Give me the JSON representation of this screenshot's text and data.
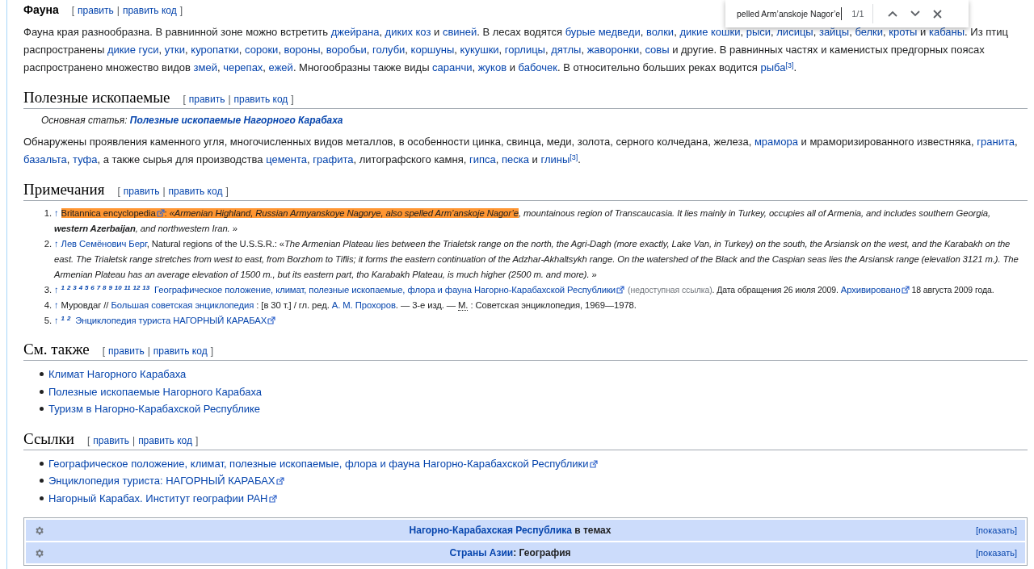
{
  "find_bar": {
    "query": "pelled Arm’anskoje Nagor’e",
    "count": "1/1"
  },
  "sections": [
    {
      "kind": "h3",
      "title": "Фауна",
      "open": "[",
      "edit": "править",
      "sep": "|",
      "edit_code": "править код",
      "close": "]",
      "blocks": [
        {
          "kind": "paragraph",
          "segments": [
            {
              "kind": "text",
              "text": "Фауна края разнообразна. В равнинной зоне можно встретить "
            },
            {
              "kind": "link",
              "text": "джейрана"
            },
            {
              "kind": "text",
              "text": ", "
            },
            {
              "kind": "link",
              "text": "диких коз"
            },
            {
              "kind": "text",
              "text": " и "
            },
            {
              "kind": "link",
              "text": "свиней"
            },
            {
              "kind": "text",
              "text": ". В лесах водятся "
            },
            {
              "kind": "link",
              "text": "бурые медведи"
            },
            {
              "kind": "text",
              "text": ", "
            },
            {
              "kind": "link",
              "text": "волки"
            },
            {
              "kind": "text",
              "text": ", "
            },
            {
              "kind": "link",
              "text": "дикие кошки"
            },
            {
              "kind": "text",
              "text": ", "
            },
            {
              "kind": "link",
              "text": "рыси"
            },
            {
              "kind": "text",
              "text": ", "
            },
            {
              "kind": "link",
              "text": "лисицы"
            },
            {
              "kind": "text",
              "text": ", "
            },
            {
              "kind": "link",
              "text": "зайцы"
            },
            {
              "kind": "text",
              "text": ", "
            },
            {
              "kind": "link",
              "text": "белки"
            },
            {
              "kind": "text",
              "text": ", "
            },
            {
              "kind": "link",
              "text": "кроты"
            },
            {
              "kind": "text",
              "text": " и "
            },
            {
              "kind": "link",
              "text": "кабаны"
            },
            {
              "kind": "text",
              "text": ". Из птиц распространены "
            },
            {
              "kind": "link",
              "text": "дикие гуси"
            },
            {
              "kind": "text",
              "text": ", "
            },
            {
              "kind": "link",
              "text": "утки"
            },
            {
              "kind": "text",
              "text": ", "
            },
            {
              "kind": "link",
              "text": "куропатки"
            },
            {
              "kind": "text",
              "text": ", "
            },
            {
              "kind": "link",
              "text": "сороки"
            },
            {
              "kind": "text",
              "text": ", "
            },
            {
              "kind": "link",
              "text": "вороны"
            },
            {
              "kind": "text",
              "text": ", "
            },
            {
              "kind": "link",
              "text": "воробьи"
            },
            {
              "kind": "text",
              "text": ", "
            },
            {
              "kind": "link",
              "text": "голуби"
            },
            {
              "kind": "text",
              "text": ", "
            },
            {
              "kind": "link",
              "text": "коршуны"
            },
            {
              "kind": "text",
              "text": ", "
            },
            {
              "kind": "link",
              "text": "кукушки"
            },
            {
              "kind": "text",
              "text": ", "
            },
            {
              "kind": "link",
              "text": "горлицы"
            },
            {
              "kind": "text",
              "text": ", "
            },
            {
              "kind": "link",
              "text": "дятлы"
            },
            {
              "kind": "text",
              "text": ", "
            },
            {
              "kind": "link",
              "text": "жаворонки"
            },
            {
              "kind": "text",
              "text": ", "
            },
            {
              "kind": "link",
              "text": "совы"
            },
            {
              "kind": "text",
              "text": " и другие. В равнинных частях и каменистых предгорных поясах распространено множество видов "
            },
            {
              "kind": "link",
              "text": "змей"
            },
            {
              "kind": "text",
              "text": ", "
            },
            {
              "kind": "link",
              "text": "черепах"
            },
            {
              "kind": "text",
              "text": ", "
            },
            {
              "kind": "link",
              "text": "ежей"
            },
            {
              "kind": "text",
              "text": ". Многообразны также виды "
            },
            {
              "kind": "link",
              "text": "саранчи"
            },
            {
              "kind": "text",
              "text": ", "
            },
            {
              "kind": "link",
              "text": "жуков"
            },
            {
              "kind": "text",
              "text": " и "
            },
            {
              "kind": "link",
              "text": "бабочек"
            },
            {
              "kind": "text",
              "text": ". В относительно больших реках водится "
            },
            {
              "kind": "link",
              "text": "рыба"
            },
            {
              "kind": "sup",
              "text": "[3]"
            },
            {
              "kind": "text",
              "text": "."
            }
          ]
        }
      ]
    },
    {
      "kind": "h2",
      "title": "Полезные ископаемые",
      "open": "[",
      "edit": "править",
      "sep": "|",
      "edit_code": "править код",
      "close": "]",
      "blocks": [
        {
          "kind": "hatnote",
          "label": "Основная статья:",
          "link": "Полезные ископаемые Нагорного Карабаха"
        },
        {
          "kind": "paragraph",
          "segments": [
            {
              "kind": "text",
              "text": "Обнаружены проявления каменного угля, многочисленных видов металлов, в особенности цинка, свинца, меди, золота, серного колчедана, железа, "
            },
            {
              "kind": "link",
              "text": "мрамора"
            },
            {
              "kind": "text",
              "text": " и мраморизированного известняка, "
            },
            {
              "kind": "link",
              "text": "гранита"
            },
            {
              "kind": "text",
              "text": ", "
            },
            {
              "kind": "link",
              "text": "базальта"
            },
            {
              "kind": "text",
              "text": ", "
            },
            {
              "kind": "link",
              "text": "туфа"
            },
            {
              "kind": "text",
              "text": ", а также сырья для производства "
            },
            {
              "kind": "link",
              "text": "цемента"
            },
            {
              "kind": "text",
              "text": ", "
            },
            {
              "kind": "link",
              "text": "графита"
            },
            {
              "kind": "text",
              "text": ", литографского камня, "
            },
            {
              "kind": "link",
              "text": "гипса"
            },
            {
              "kind": "text",
              "text": ", "
            },
            {
              "kind": "link",
              "text": "песка"
            },
            {
              "kind": "text",
              "text": " и "
            },
            {
              "kind": "link",
              "text": "глины"
            },
            {
              "kind": "sup",
              "text": "[3]"
            },
            {
              "kind": "text",
              "text": "."
            }
          ]
        }
      ]
    },
    {
      "kind": "h2",
      "title": "Примечания",
      "open": "[",
      "edit": "править",
      "sep": "|",
      "edit_code": "править код",
      "close": "]",
      "blocks": [
        {
          "kind": "references",
          "items": [
            {
              "number": "1.",
              "arrow": "↑",
              "highlighted": [
                {
                  "kind": "ext",
                  "text": "Britannica encyclopedia"
                },
                {
                  "kind": "text",
                  "text": ": "
                },
                {
                  "kind": "italic",
                  "text": "«Armenian Highland, Russian Armyanskoye Nagorye, also spelled Arm’anskoje Nagor’e"
                }
              ],
              "segments": [
                {
                  "kind": "italic",
                  "text": ", mountainous region of Transcaucasia. It lies mainly in Turkey, occupies all of Armenia, and includes southern Georgia, "
                },
                {
                  "kind": "bolditalic",
                  "text": "western Azerbaijan"
                },
                {
                  "kind": "italic",
                  "text": ", and northwestern Iran."
                },
                {
                  "kind": "text",
                  "text": " »"
                }
              ]
            },
            {
              "number": "2.",
              "arrow": "↑",
              "segments": [
                {
                  "kind": "link",
                  "text": "Лев Семёнович Берг"
                },
                {
                  "kind": "text",
                  "text": ", Natural regions of the U.S.S.R.: «"
                },
                {
                  "kind": "italic",
                  "text": "The Armenian Plateau lies between the Trialetsk range on the north, the Agri-Dagh (more exactly, Lake Van, in Turkey) on the south, the Arsiansk on the west, and the Karabakh on the east. The Trialetsk range stretches from west to east, from Borzhom to Tiflis; it forms the eastern continuation of the Adzhar-Akhaltsykh range. On the watershed of the Black and the Caspian seas lies the Arsiansk range (elevation 3121 m.). The Armenian Plateau has an average elevation of 1500 m., but its eastern part, tho Karabakh Plateau, is much higher (2500 m. and more)."
                },
                {
                  "kind": "text",
                  "text": " »"
                }
              ]
            },
            {
              "number": "3.",
              "arrow": "↑",
              "backlinks": [
                "1",
                "2",
                "3",
                "4",
                "5",
                "6",
                "7",
                "8",
                "9",
                "10",
                "11",
                "12",
                "13"
              ],
              "segments": [
                {
                  "kind": "ext",
                  "text": "Географическое положение, климат, полезные ископаемые, флора и фауна Нагорно-Карабахской Республики"
                },
                {
                  "kind": "grey",
                  "text": "(недоступная ссылка)"
                },
                {
                  "kind": "small",
                  "text": ". Дата обращения 26 июля 2009. "
                },
                {
                  "kind": "ext",
                  "text": "Архивировано"
                },
                {
                  "kind": "small",
                  "text": " 18 августа 2009 года."
                }
              ]
            },
            {
              "number": "4.",
              "arrow": "↑",
              "segments": [
                {
                  "kind": "text",
                  "text": "Муровдаг // "
                },
                {
                  "kind": "link",
                  "text": "Большая советская энциклопедия"
                },
                {
                  "kind": "text",
                  "text": " : [в 30 т.] / гл. ред. "
                },
                {
                  "kind": "link",
                  "text": "А. М. Прохоров"
                },
                {
                  "kind": "text",
                  "text": ". — 3-е изд. — "
                },
                {
                  "kind": "abbr",
                  "text": "М."
                },
                {
                  "kind": "text",
                  "text": " : Советская энциклопедия, 1969—1978."
                }
              ]
            },
            {
              "number": "5.",
              "arrow": "↑",
              "backlinks": [
                "1",
                "2"
              ],
              "segments": [
                {
                  "kind": "ext",
                  "text": "Энциклопедия туриста НАГОРНЫЙ КАРАБАХ"
                }
              ]
            }
          ]
        }
      ]
    },
    {
      "kind": "h2",
      "title": "См. также",
      "open": "[",
      "edit": "править",
      "sep": "|",
      "edit_code": "править код",
      "close": "]",
      "blocks": [
        {
          "kind": "bullets",
          "items": [
            [
              {
                "kind": "link",
                "text": "Климат Нагорного Карабаха"
              }
            ],
            [
              {
                "kind": "link",
                "text": "Полезные ископаемые Нагорного Карабаха"
              }
            ],
            [
              {
                "kind": "link",
                "text": "Туризм в Нагорно-Карабахской Республике"
              }
            ]
          ]
        }
      ]
    },
    {
      "kind": "h2",
      "title": "Ссылки",
      "open": "[",
      "edit": "править",
      "sep": "|",
      "edit_code": "править код",
      "close": "]",
      "blocks": [
        {
          "kind": "bullets",
          "items": [
            [
              {
                "kind": "ext",
                "text": "Географическое положение, климат, полезные ископаемые, флора и фауна Нагорно-Карабахской Республики"
              }
            ],
            [
              {
                "kind": "ext",
                "text": "Энциклопедия туриста: НАГОРНЫЙ КАРАБАХ"
              }
            ],
            [
              {
                "kind": "ext",
                "text": "Нагорный Карабах. Институт географии РАН"
              }
            ]
          ]
        }
      ]
    }
  ],
  "navboxes": [
    {
      "link": "Нагорно-Карабахская Республика",
      "text": " в темах",
      "toggle": "[показать]"
    },
    {
      "link": "Страны Азии",
      "text": ": География",
      "toggle": "[показать]"
    }
  ]
}
